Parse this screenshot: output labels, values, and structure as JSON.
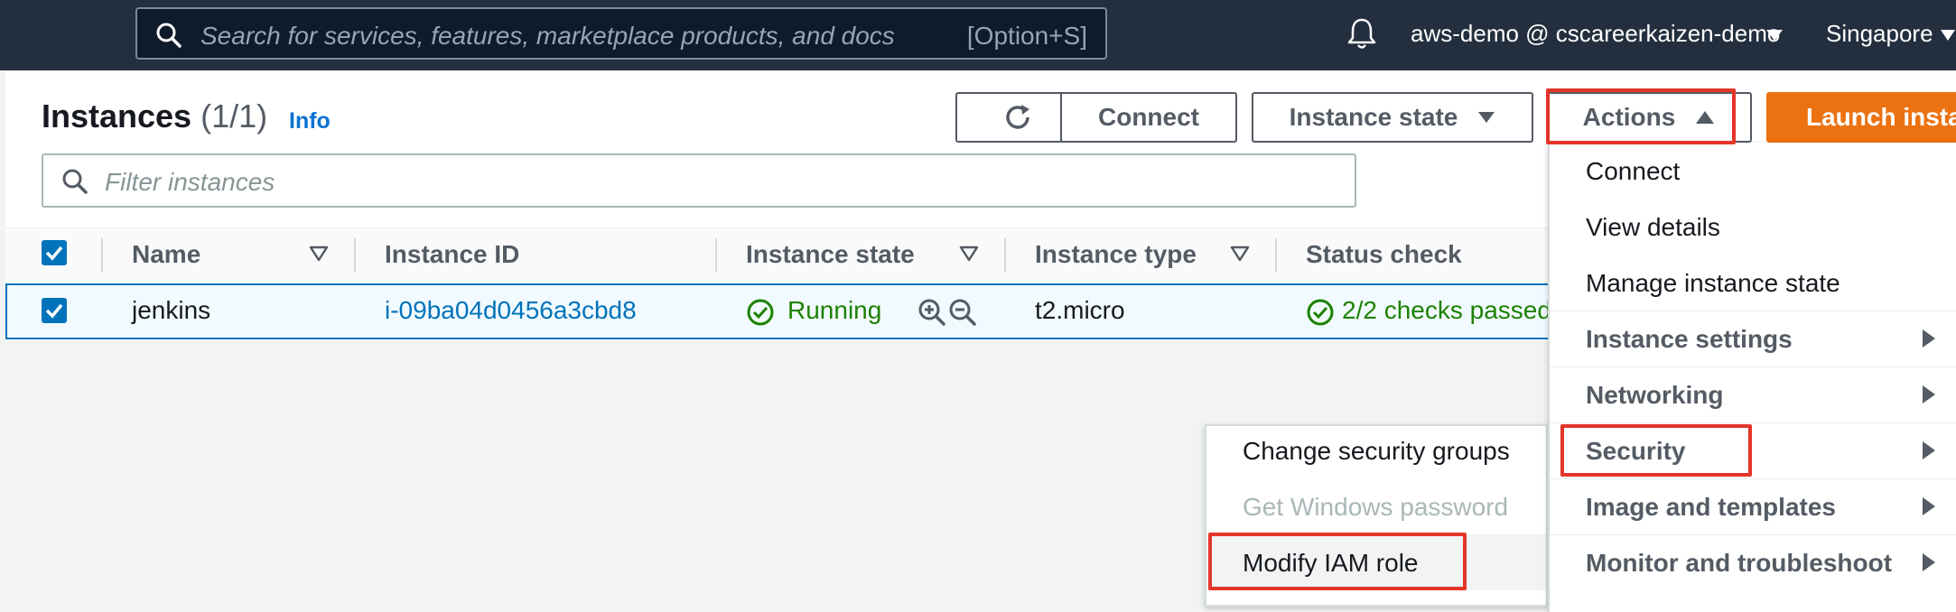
{
  "topnav": {
    "search_placeholder": "Search for services, features, marketplace products, and docs",
    "search_shortcut": "[Option+S]",
    "account": "aws-demo @ cscareerkaizen-demo",
    "region": "Singapore"
  },
  "header": {
    "title": "Instances",
    "count": "(1/1)",
    "info": "Info"
  },
  "toolbar": {
    "connect_label": "Connect",
    "instance_state_label": "Instance state",
    "actions_label": "Actions",
    "launch_label": "Launch insta"
  },
  "filter": {
    "placeholder": "Filter instances"
  },
  "table": {
    "columns": [
      "Name",
      "Instance ID",
      "Instance state",
      "Instance type",
      "Status check"
    ],
    "rows": [
      {
        "name": "jenkins",
        "instance_id": "i-09ba04d0456a3cbd8",
        "state": "Running",
        "type": "t2.micro",
        "status": "2/2 checks passed"
      }
    ]
  },
  "actions_menu": {
    "items": [
      "Connect",
      "View details",
      "Manage instance state"
    ],
    "groups": [
      "Instance settings",
      "Networking",
      "Security",
      "Image and templates",
      "Monitor and troubleshoot"
    ]
  },
  "security_submenu": {
    "items": [
      {
        "label": "Change security groups",
        "enabled": true
      },
      {
        "label": "Get Windows password",
        "enabled": false
      },
      {
        "label": "Modify IAM role",
        "enabled": true
      }
    ]
  },
  "colors": {
    "nav_bg": "#232f3e",
    "accent_blue": "#0073bb",
    "launch_orange": "#ec7211",
    "running_green": "#1d8102",
    "highlight_red": "#e4352a"
  },
  "icons": [
    "search-icon",
    "bell-icon",
    "refresh-icon",
    "check-circle-icon",
    "zoom-in-icon",
    "zoom-out-icon",
    "sort-icon",
    "caret-right-icon"
  ]
}
